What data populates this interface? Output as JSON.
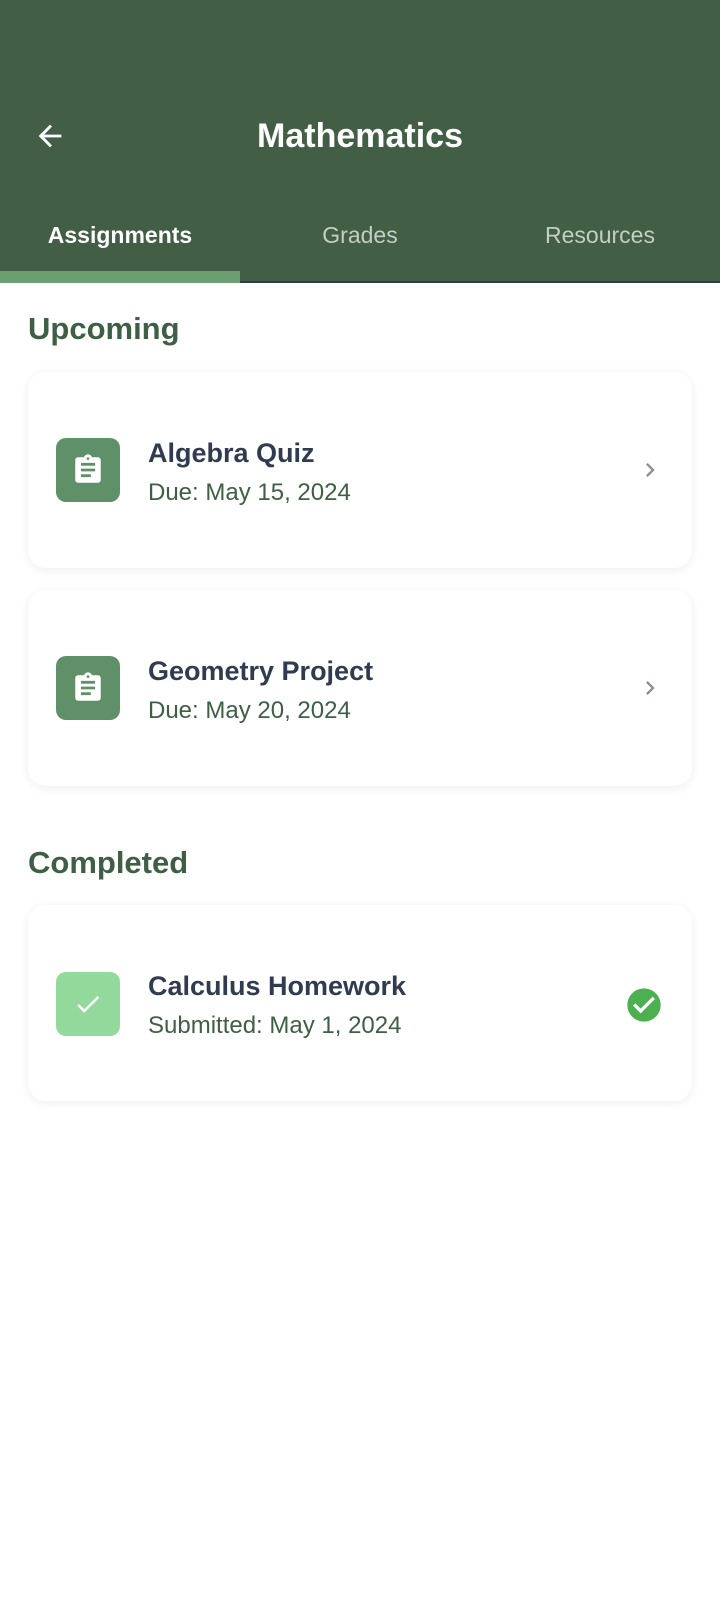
{
  "header": {
    "title": "Mathematics",
    "back_icon": "arrow-left-icon",
    "background": "#425f45"
  },
  "tabs": [
    {
      "label": "Assignments",
      "active": true
    },
    {
      "label": "Grades",
      "active": false
    },
    {
      "label": "Resources",
      "active": false
    }
  ],
  "sections": {
    "upcoming": {
      "title": "Upcoming",
      "items": [
        {
          "title": "Algebra Quiz",
          "subtitle": "Due: May 15, 2024",
          "icon": "clipboard-icon",
          "action_icon": "chevron-right-icon"
        },
        {
          "title": "Geometry Project",
          "subtitle": "Due: May 20, 2024",
          "icon": "clipboard-icon",
          "action_icon": "chevron-right-icon"
        }
      ]
    },
    "completed": {
      "title": "Completed",
      "items": [
        {
          "title": "Calculus Homework",
          "subtitle": "Submitted: May 1, 2024",
          "icon": "check-icon",
          "status_icon": "check-circle-icon"
        }
      ]
    }
  },
  "colors": {
    "accent": "#5f9068",
    "tab_indicator": "#6b9e70",
    "completed_icon_bg": "#93d99b",
    "success": "#4caf50",
    "section_title": "#3f5f44",
    "item_title": "#2f3b4f"
  }
}
